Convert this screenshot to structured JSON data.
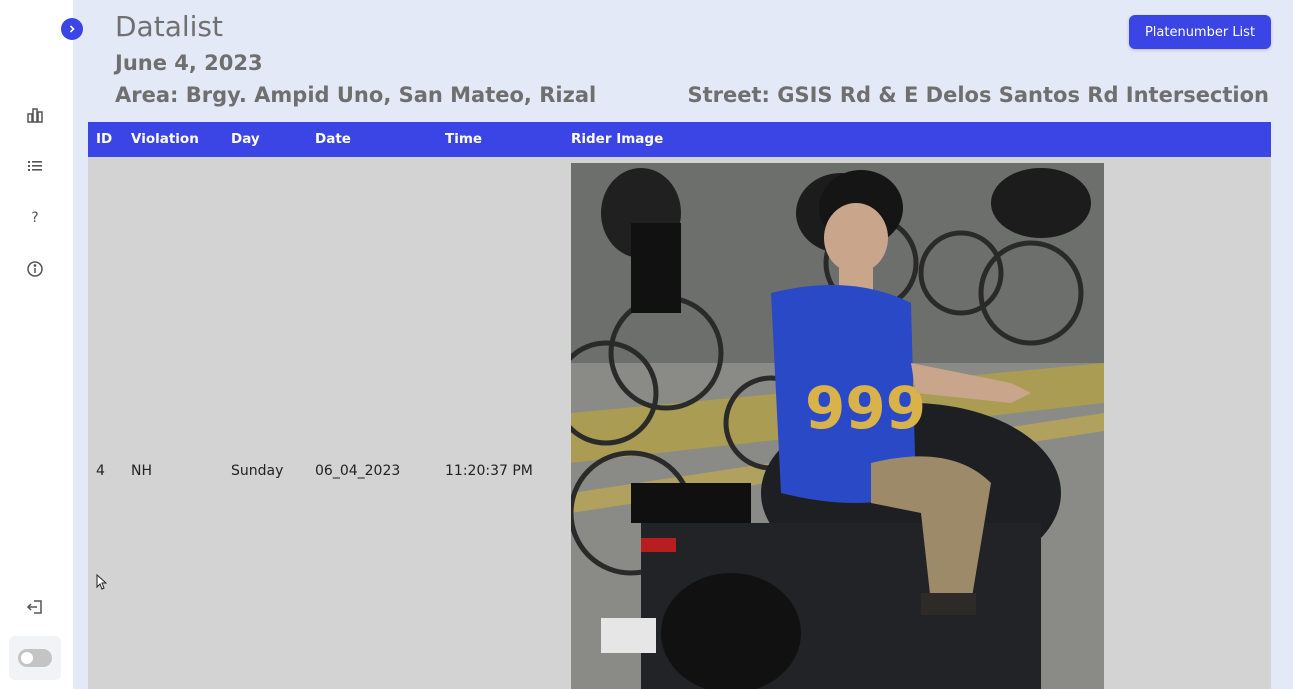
{
  "sidebar": {
    "items": [
      {
        "icon": "bar-chart-icon"
      },
      {
        "icon": "list-icon"
      },
      {
        "icon": "help-icon",
        "glyph": "?"
      },
      {
        "icon": "info-icon"
      }
    ],
    "logout_icon": "logout-icon",
    "theme_toggle": {
      "state": "off"
    }
  },
  "header": {
    "title": "Datalist",
    "date": "June 4, 2023",
    "area": "Area: Brgy. Ampid Uno, San Mateo, Rizal",
    "street": "Street: GSIS Rd & E Delos Santos Rd Intersection",
    "platenumber_button": "Platenumber List"
  },
  "table": {
    "columns": [
      "ID",
      "Violation",
      "Day",
      "Date",
      "Time",
      "Rider Image"
    ],
    "rows": [
      {
        "id": "4",
        "violation": "NH",
        "day": "Sunday",
        "date": "06_04_2023",
        "time": "11:20:37 PM",
        "jersey_text": "999"
      }
    ]
  },
  "colors": {
    "accent": "#3b45e6",
    "background": "#e4e9f7",
    "table_body": "#d3d3d3"
  }
}
